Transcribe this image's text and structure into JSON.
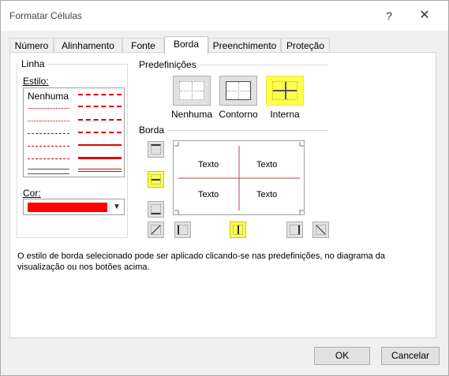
{
  "window": {
    "title": "Formatar Células",
    "help": "?",
    "close": "✕"
  },
  "tabs": [
    {
      "label": "Número"
    },
    {
      "label": "Alinhamento"
    },
    {
      "label": "Fonte"
    },
    {
      "label": "Borda"
    },
    {
      "label": "Preenchimento"
    },
    {
      "label": "Proteção"
    }
  ],
  "active_tab": "Borda",
  "line_group": {
    "title": "Linha",
    "style_label": "Estilo:",
    "none_option": "Nenhuma",
    "color_label": "Cor:",
    "color_value": "#ff0000"
  },
  "presets": {
    "title": "Predefinições",
    "items": [
      {
        "label": "Nenhuma",
        "highlighted": false
      },
      {
        "label": "Contorno",
        "highlighted": false
      },
      {
        "label": "Interna",
        "highlighted": true
      }
    ]
  },
  "border": {
    "title": "Borda",
    "preview_texts": [
      "Texto",
      "Texto",
      "Texto",
      "Texto"
    ],
    "line_color": "#c04050",
    "highlighted_buttons": [
      "inside-horizontal",
      "inside-vertical"
    ]
  },
  "description": "O estilo de borda selecionado pode ser aplicado clicando-se nas predefinições, no diagrama da visualização ou nos botões acima.",
  "buttons": {
    "ok": "OK",
    "cancel": "Cancelar"
  },
  "highlight_color": "#ffff4d"
}
